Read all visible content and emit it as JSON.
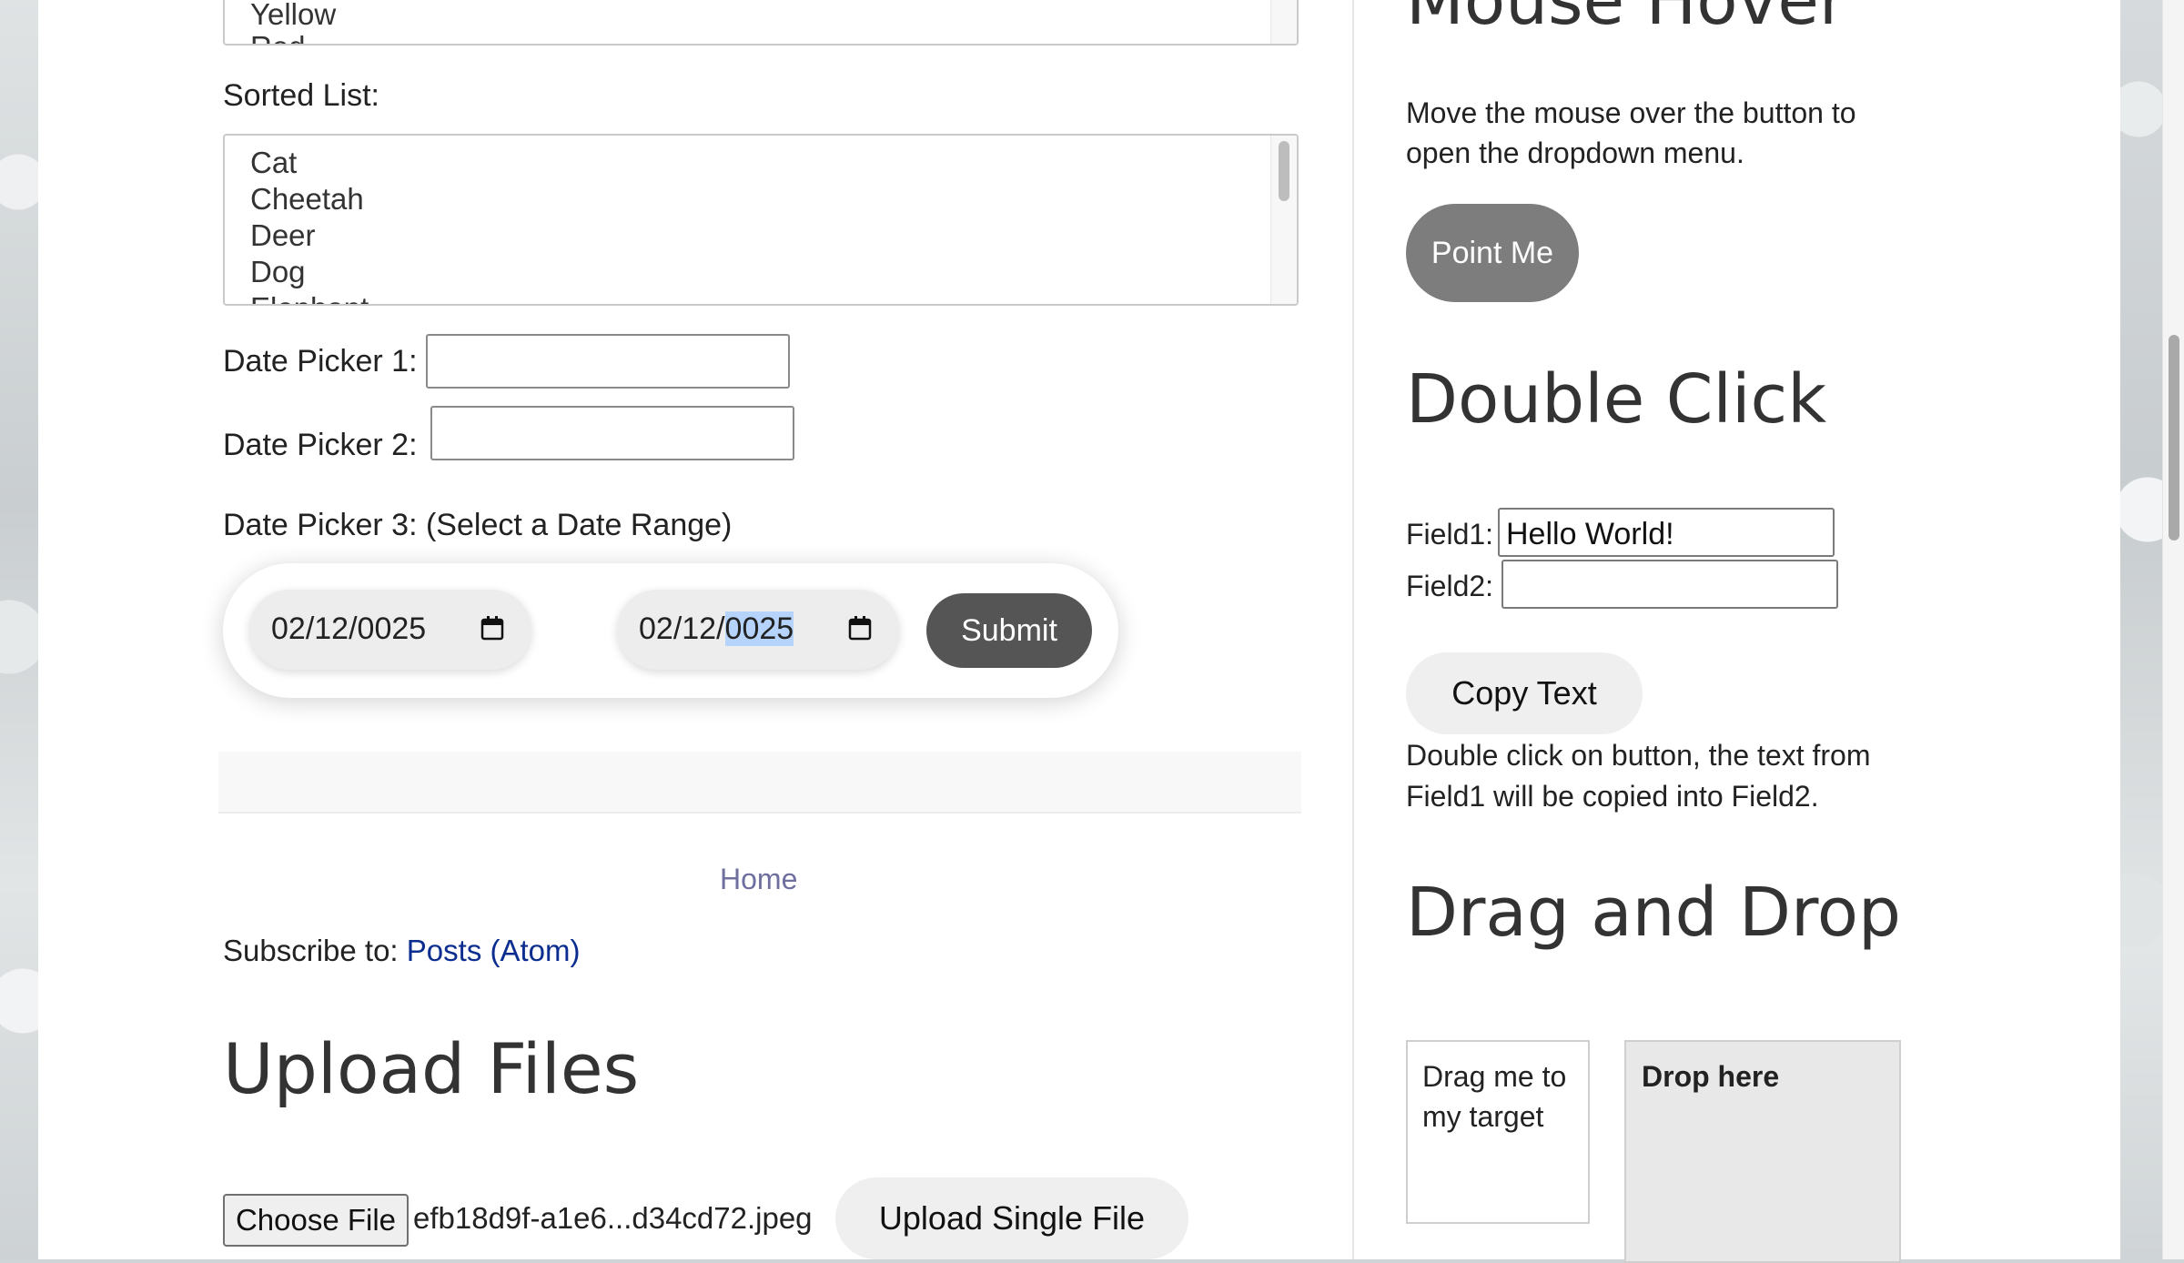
{
  "colors_list": {
    "visible_options": [
      "Yellow",
      "Red"
    ]
  },
  "sorted_list": {
    "label": "Sorted List:",
    "options": [
      "Cat",
      "Cheetah",
      "Deer",
      "Dog",
      "Elephant"
    ]
  },
  "date_picker_1": {
    "label": "Date Picker 1:"
  },
  "date_picker_2": {
    "label": "Date Picker 2:"
  },
  "date_picker_3": {
    "label": "Date Picker 3: (Select a Date Range)",
    "start_date": "02/12/0025",
    "end_date_prefix": "02/12/",
    "end_date_selected": "0025",
    "submit_label": "Submit"
  },
  "footer": {
    "home_link": "Home",
    "subscribe_prefix": "Subscribe to: ",
    "subscribe_link": "Posts (Atom)"
  },
  "upload": {
    "heading": "Upload Files",
    "choose_label": "Choose File",
    "file_name": "efb18d9f-a1e6...d34cd72.jpeg",
    "upload_single_label": "Upload Single File"
  },
  "mouse_hover": {
    "heading": "Mouse Hover",
    "description_line1": "Move the mouse over the button to",
    "description_line2": "open the dropdown menu.",
    "button_label": "Point Me"
  },
  "double_click": {
    "heading": "Double Click",
    "field1_label": "Field1:",
    "field1_value": "Hello World!",
    "field2_label": "Field2:",
    "field2_value": "",
    "button_label": "Copy Text",
    "description_line1": "Double click on button, the text from",
    "description_line2": "Field1 will be copied into Field2."
  },
  "drag_and_drop": {
    "heading": "Drag and Drop",
    "drag_line1": "Drag me to",
    "drag_line2": "my target",
    "drop_label": "Drop here"
  },
  "icons": [
    "calendar-icon"
  ]
}
